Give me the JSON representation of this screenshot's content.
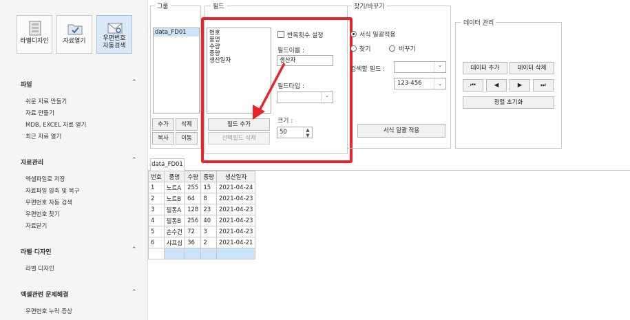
{
  "toolbar": {
    "label_design": "라벨디자인",
    "open_data": "자료열기",
    "zip_search": "우편번호\n자동검색"
  },
  "sidebar": {
    "sections": [
      {
        "title": "파일",
        "items": [
          "쉬운 자료 만들기",
          "자료 만들기",
          "MDB, EXCEL 자료 열기",
          "최근 자료 열기"
        ]
      },
      {
        "title": "자료관리",
        "items": [
          "엑셀파일로 저장",
          "자료파일 압축 및 복구",
          "우편번호 자동 검색",
          "우편번호 찾기",
          "자료닫기"
        ]
      },
      {
        "title": "라벨 디자인",
        "items": [
          "라벨 디자인"
        ]
      },
      {
        "title": "엑셀관련 문제해결",
        "items": [
          "우편번호 누락 증상"
        ]
      }
    ]
  },
  "group": {
    "legend": "그룹",
    "items": [
      "data_FD01"
    ],
    "add": "추가",
    "delete": "삭제",
    "copy": "복사",
    "move": "이동"
  },
  "field": {
    "legend": "필드",
    "items": [
      "번호",
      "품명",
      "수량",
      "중량",
      "생산일자"
    ],
    "repeat_label": "반복횟수 설정",
    "name_label": "필드이름 :",
    "name_value": "생산자",
    "type_label": "필드타입 :",
    "size_label": "크기 :",
    "size_value": "50",
    "add_field": "필드 추가",
    "delete_selected": "선택필드 삭제"
  },
  "find": {
    "legend": "찾기/바꾸기",
    "format_apply": "서식 일괄적용",
    "find": "찾기",
    "replace": "바꾸기",
    "search_field_label": "검색할 필드 :",
    "format_value": "123-456",
    "apply_button": "서식 일괄 적용"
  },
  "data_mgmt": {
    "legend": "데이터 관리",
    "add": "데이터 추가",
    "delete": "데이터 삭제",
    "first": "⏮",
    "prev": "◀",
    "next": "▶",
    "last": "⏭",
    "reset_sort": "정렬 초기화"
  },
  "tab": {
    "label": "data_FD01"
  },
  "table": {
    "headers": [
      "번호",
      "품명",
      "수량",
      "중량",
      "생산일자"
    ],
    "rows": [
      [
        "1",
        "노트A",
        "255",
        "15",
        "2021-04-24"
      ],
      [
        "2",
        "노트B",
        "64",
        "8",
        "2021-04-23"
      ],
      [
        "3",
        "필통A",
        "128",
        "23",
        "2021-04-23"
      ],
      [
        "4",
        "필통B",
        "256",
        "40",
        "2021-04-23"
      ],
      [
        "5",
        "손수건",
        "72",
        "3",
        "2021-04-23"
      ],
      [
        "6",
        "샤프심",
        "36",
        "2",
        "2021-04-21"
      ]
    ]
  },
  "colors": {
    "highlight": "#e8242a",
    "accent": "#3a6ea5",
    "selection": "#cce4f7"
  }
}
